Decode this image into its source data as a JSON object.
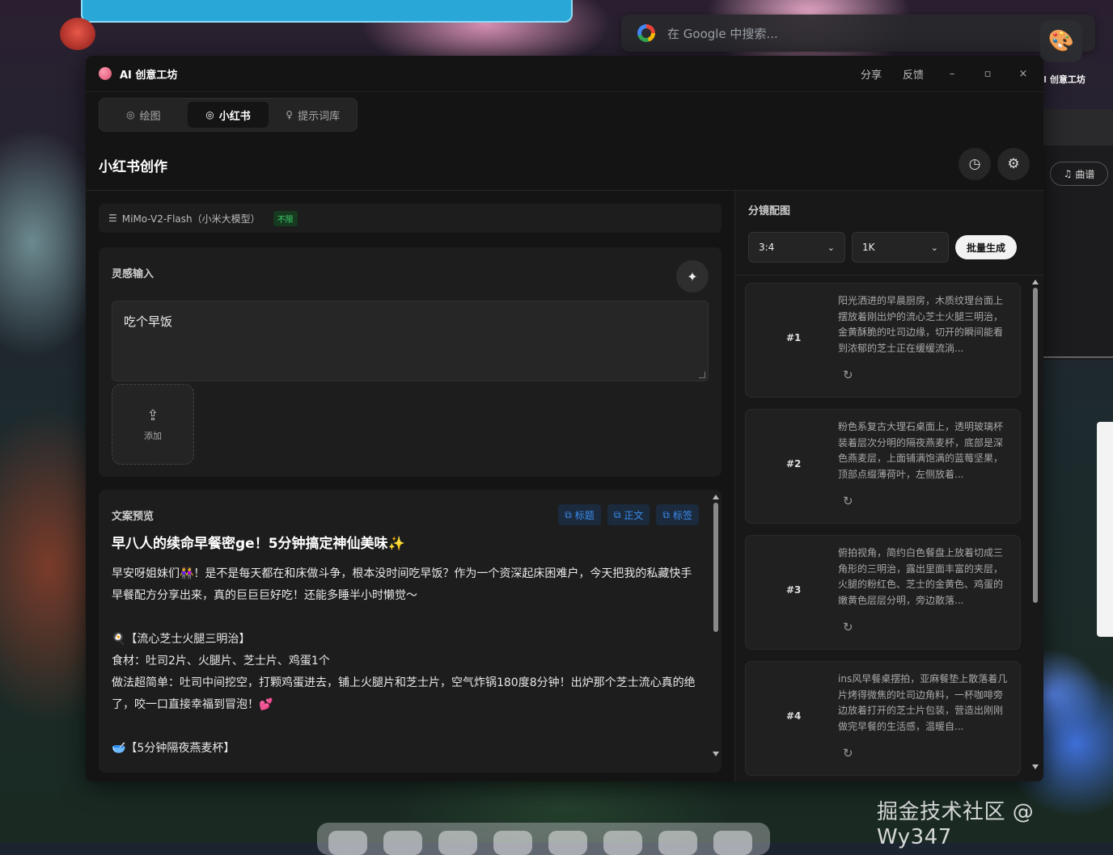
{
  "desktop": {
    "search_placeholder": "在 Google 中搜索...",
    "side_app_label": "I 创意工坊",
    "behind_button": "曲谱",
    "watermark": "掘金技术社区 @ Wy347"
  },
  "window": {
    "title": "AI 创意工坊",
    "share": "分享",
    "feedback": "反馈",
    "minimize": "–",
    "maximize": "▫",
    "close": "×"
  },
  "tabs": [
    {
      "label": "绘图",
      "icon": "palette-icon"
    },
    {
      "label": "小红书",
      "icon": "palette-icon",
      "active": true
    },
    {
      "label": "提示词库",
      "icon": "lightbulb-icon"
    }
  ],
  "page": {
    "title": "小红书创作"
  },
  "model": {
    "name": "MiMo-V2-Flash（小米大模型）",
    "badge": "不限"
  },
  "inspiration": {
    "label": "灵感输入",
    "input_value": "吃个早饭",
    "add_label": "添加"
  },
  "preview": {
    "label": "文案预览",
    "tools": [
      "标题",
      "正文",
      "标签"
    ],
    "title": "早八人的续命早餐密ge！5分钟搞定神仙美味✨",
    "paragraphs": [
      "早安呀姐妹们👭！是不是每天都在和床做斗争，根本没时间吃早饭？作为一个资深起床困难户，今天把我的私藏快手早餐配方分享出来，真的巨巨巨好吃！还能多睡半小时懒觉～",
      "",
      "🍳【流心芝士火腿三明治】",
      "食材：吐司2片、火腿片、芝士片、鸡蛋1个",
      "做法超简单：吐司中间挖空，打颗鸡蛋进去，铺上火腿片和芝士片，空气炸锅180度8分钟！出炉那个芝士流心真的绝了，咬一口直接幸福到冒泡！💕",
      "",
      "🥣【5分钟隔夜燕麦杯】"
    ]
  },
  "storyboard": {
    "label": "分镜配图",
    "ratio": "3:4",
    "resolution": "1K",
    "batch_label": "批量生成",
    "shots": [
      {
        "num": "#1",
        "desc": "阳光洒进的早晨厨房，木质纹理台面上摆放着刚出炉的流心芝士火腿三明治，金黄酥脆的吐司边缘，切开的瞬间能看到浓郁的芝士正在缓缓流淌..."
      },
      {
        "num": "#2",
        "desc": "粉色系复古大理石桌面上，透明玻璃杯装着层次分明的隔夜燕麦杯，底部是深色燕麦层，上面铺满饱满的蓝莓坚果，顶部点缀薄荷叶，左侧放着..."
      },
      {
        "num": "#3",
        "desc": "俯拍视角，简约白色餐盘上放着切成三角形的三明治，露出里面丰富的夹层，火腿的粉红色、芝士的金黄色、鸡蛋的嫩黄色层层分明，旁边散落..."
      },
      {
        "num": "#4",
        "desc": "ins风早餐桌摆拍，亚麻餐垫上散落着几片烤得微焦的吐司边角料，一杯咖啡旁边放着打开的芝士片包装，营造出刚刚做完早餐的生活感，温暖自..."
      }
    ]
  }
}
